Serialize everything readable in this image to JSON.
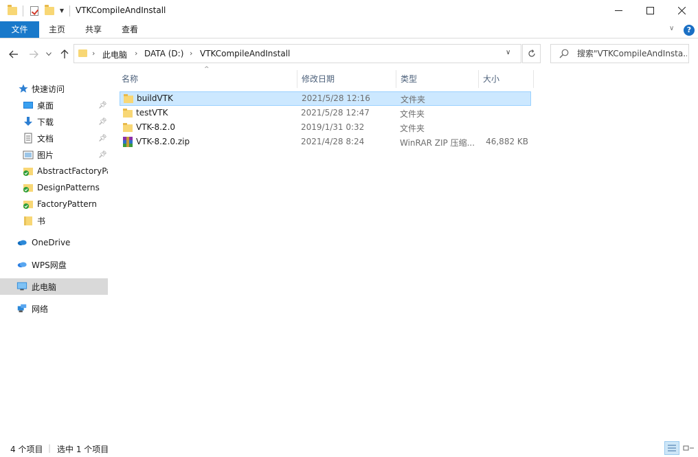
{
  "window": {
    "title": "VTKCompileAndInstall",
    "controls": {
      "minimize": "minimize",
      "maximize": "maximize",
      "close": "close"
    }
  },
  "ribbon": {
    "tabs": [
      {
        "label": "文件"
      },
      {
        "label": "主页"
      },
      {
        "label": "共享"
      },
      {
        "label": "查看"
      }
    ],
    "help": "?"
  },
  "address": {
    "breadcrumb": [
      "此电脑",
      "DATA (D:)",
      "VTKCompileAndInstall"
    ]
  },
  "search": {
    "placeholder": "搜索\"VTKCompileAndInsta..."
  },
  "sidebar": {
    "items": [
      {
        "label": "快速访问",
        "icon": "star-icon"
      },
      {
        "label": "桌面",
        "icon": "desktop-icon",
        "pinned": true
      },
      {
        "label": "下载",
        "icon": "download-icon",
        "pinned": true
      },
      {
        "label": "文档",
        "icon": "document-icon",
        "pinned": true
      },
      {
        "label": "图片",
        "icon": "picture-icon",
        "pinned": true
      },
      {
        "label": "AbstractFactoryPa",
        "icon": "folder-synced-icon"
      },
      {
        "label": "DesignPatterns",
        "icon": "folder-synced-icon"
      },
      {
        "label": "FactoryPattern",
        "icon": "folder-synced-icon"
      },
      {
        "label": "书",
        "icon": "folder-icon"
      },
      {
        "label": "OneDrive",
        "icon": "cloud-icon"
      },
      {
        "label": "WPS网盘",
        "icon": "cloud-icon"
      },
      {
        "label": "此电脑",
        "icon": "computer-icon",
        "selected": true
      },
      {
        "label": "网络",
        "icon": "network-icon"
      }
    ]
  },
  "columns": {
    "name": "名称",
    "date": "修改日期",
    "type": "类型",
    "size": "大小"
  },
  "files": [
    {
      "name": "buildVTK",
      "date": "2021/5/28 12:16",
      "type": "文件夹",
      "size": "",
      "icon": "folder-icon",
      "selected": true
    },
    {
      "name": "testVTK",
      "date": "2021/5/28 12:47",
      "type": "文件夹",
      "size": "",
      "icon": "folder-icon"
    },
    {
      "name": "VTK-8.2.0",
      "date": "2019/1/31 0:32",
      "type": "文件夹",
      "size": "",
      "icon": "folder-icon"
    },
    {
      "name": "VTK-8.2.0.zip",
      "date": "2021/4/28 8:24",
      "type": "WinRAR ZIP 压缩...",
      "size": "46,882 KB",
      "icon": "winrar-archive-icon"
    }
  ],
  "status": {
    "item_count": "4 个项目",
    "selected_count": "选中 1 个项目"
  },
  "colors": {
    "accent": "#1979ca",
    "selection": "#cce8ff",
    "folder": "#f8d775"
  }
}
